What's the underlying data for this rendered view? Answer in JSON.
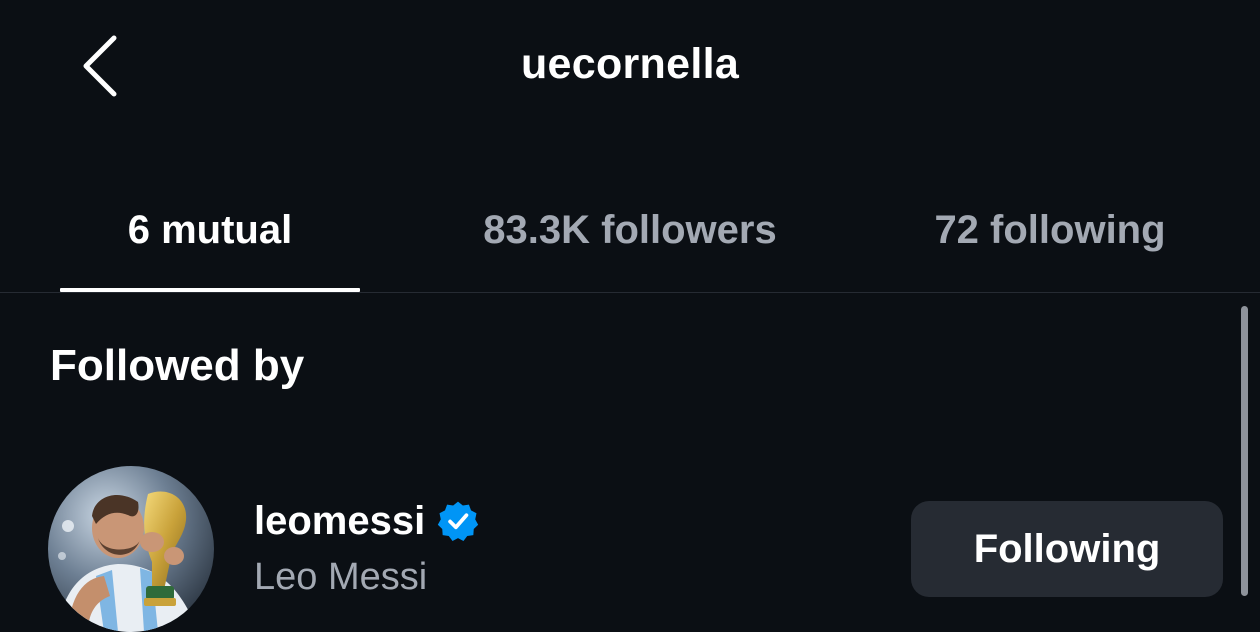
{
  "header": {
    "title": "uecornella",
    "back_icon": "chevron-left-icon"
  },
  "tabs": [
    {
      "label": "6 mutual",
      "active": true
    },
    {
      "label": "83.3K followers",
      "active": false
    },
    {
      "label": "72 following",
      "active": false
    }
  ],
  "section": {
    "heading": "Followed by"
  },
  "users": [
    {
      "username": "leomessi",
      "full_name": "Leo Messi",
      "verified": true,
      "verified_icon": "verified-badge-icon",
      "button_label": "Following"
    }
  ],
  "colors": {
    "background": "#0b0f14",
    "text_primary": "#ffffff",
    "text_secondary": "#a3a9b3",
    "button_bg": "#262b33",
    "verified_blue": "#0095f6"
  }
}
